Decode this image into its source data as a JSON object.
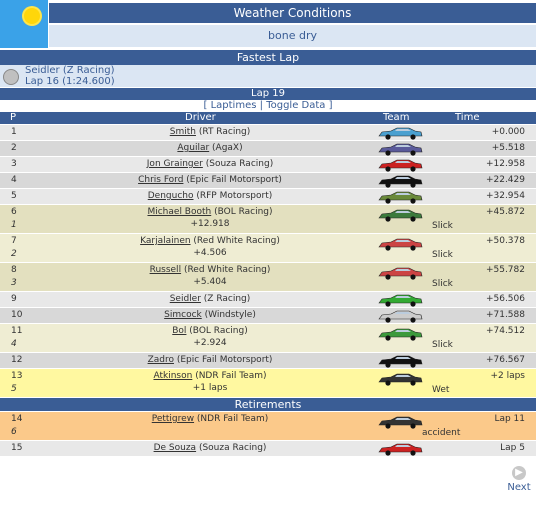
{
  "weather": {
    "title": "Weather Conditions",
    "value": "bone dry",
    "icon": "sun-icon"
  },
  "fastest_lap": {
    "title": "Fastest Lap",
    "driver": "Seidler (Z Racing)",
    "lap": "Lap 16 (1:24.600)"
  },
  "lap_header": "Lap 19",
  "links": {
    "open": "[",
    "laptimes": "Laptimes",
    "sep": "|",
    "toggle": "Toggle Data",
    "close": "]"
  },
  "columns": {
    "p": "P",
    "driver": "Driver",
    "team": "Team",
    "time": "Time"
  },
  "rows": [
    {
      "pos": "1",
      "name": "Smith",
      "team": "(RT Racing)",
      "time": "+0.000",
      "gap": "",
      "diff": "",
      "note": "",
      "bg": "#e8e8e8",
      "car": "#4aa0d0",
      "tall": false
    },
    {
      "pos": "2",
      "name": "Aguilar",
      "team": "(AgaX)",
      "time": "+5.518",
      "gap": "",
      "diff": "",
      "note": "",
      "bg": "#d8d8d8",
      "car": "#5a5a9a",
      "tall": false
    },
    {
      "pos": "3",
      "name": "Jon Grainger",
      "team": "(Souza Racing)",
      "time": "+12.958",
      "gap": "",
      "diff": "",
      "note": "",
      "bg": "#e8e8e8",
      "car": "#cc2222",
      "tall": false
    },
    {
      "pos": "4",
      "name": "Chris Ford",
      "team": "(Epic Fail Motorsport)",
      "time": "+22.429",
      "gap": "",
      "diff": "",
      "note": "",
      "bg": "#d8d8d8",
      "car": "#111111",
      "tall": false
    },
    {
      "pos": "5",
      "name": "Dengucho",
      "team": "(RFP Motorsport)",
      "time": "+32.954",
      "gap": "",
      "diff": "",
      "note": "",
      "bg": "#e8e8e8",
      "car": "#6a8a3a",
      "tall": false
    },
    {
      "pos": "6",
      "name": "Michael Booth",
      "team": "(BOL Racing)",
      "time": "+45.872",
      "gap": "1",
      "diff": "+12.918",
      "note": "Slick",
      "bg": "#e3e0bf",
      "car": "#3c7a3c",
      "tall": true
    },
    {
      "pos": "7",
      "name": "Karjalainen",
      "team": "(Red White Racing)",
      "time": "+50.378",
      "gap": "2",
      "diff": "+4.506",
      "note": "Slick",
      "bg": "#efedd3",
      "car": "#cc4444",
      "tall": true
    },
    {
      "pos": "8",
      "name": "Russell",
      "team": "(Red White Racing)",
      "time": "+55.782",
      "gap": "3",
      "diff": "+5.404",
      "note": "Slick",
      "bg": "#e3e0bf",
      "car": "#cc4444",
      "tall": true
    },
    {
      "pos": "9",
      "name": "Seidler",
      "team": "(Z Racing)",
      "time": "+56.506",
      "gap": "",
      "diff": "",
      "note": "",
      "bg": "#e8e8e8",
      "car": "#33aa33",
      "tall": false
    },
    {
      "pos": "10",
      "name": "Simcock",
      "team": "(Windstyle)",
      "time": "+71.588",
      "gap": "",
      "diff": "",
      "note": "",
      "bg": "#d8d8d8",
      "car": "#cccccc",
      "tall": false
    },
    {
      "pos": "11",
      "name": "Bol",
      "team": "(BOL Racing)",
      "time": "+74.512",
      "gap": "4",
      "diff": "+2.924",
      "note": "Slick",
      "bg": "#efedd3",
      "car": "#3c9a3c",
      "tall": true
    },
    {
      "pos": "12",
      "name": "Zadro",
      "team": "(Epic Fail Motorsport)",
      "time": "+76.567",
      "gap": "",
      "diff": "",
      "note": "",
      "bg": "#d8d8d8",
      "car": "#111111",
      "tall": false
    },
    {
      "pos": "13",
      "name": "Atkinson",
      "team": "(NDR Fail Team)",
      "time": "+2 laps",
      "gap": "5",
      "diff": "+1 laps",
      "note": "Wet",
      "bg": "#fff8a0",
      "car": "#333333",
      "tall": true
    }
  ],
  "retirements_title": "Retirements",
  "retirements": [
    {
      "pos": "14",
      "name": "Pettigrew",
      "team": "(NDR Fail Team)",
      "time": "Lap 11",
      "gap": "6",
      "diff": "",
      "note": "accident",
      "bg": "#fbc98a",
      "car": "#333333",
      "tall": true
    },
    {
      "pos": "15",
      "name": "De Souza",
      "team": "(Souza Racing)",
      "time": "Lap 5",
      "gap": "",
      "diff": "",
      "note": "",
      "bg": "#e8e8e8",
      "car": "#cc2222",
      "tall": false
    }
  ],
  "next_label": "Next"
}
